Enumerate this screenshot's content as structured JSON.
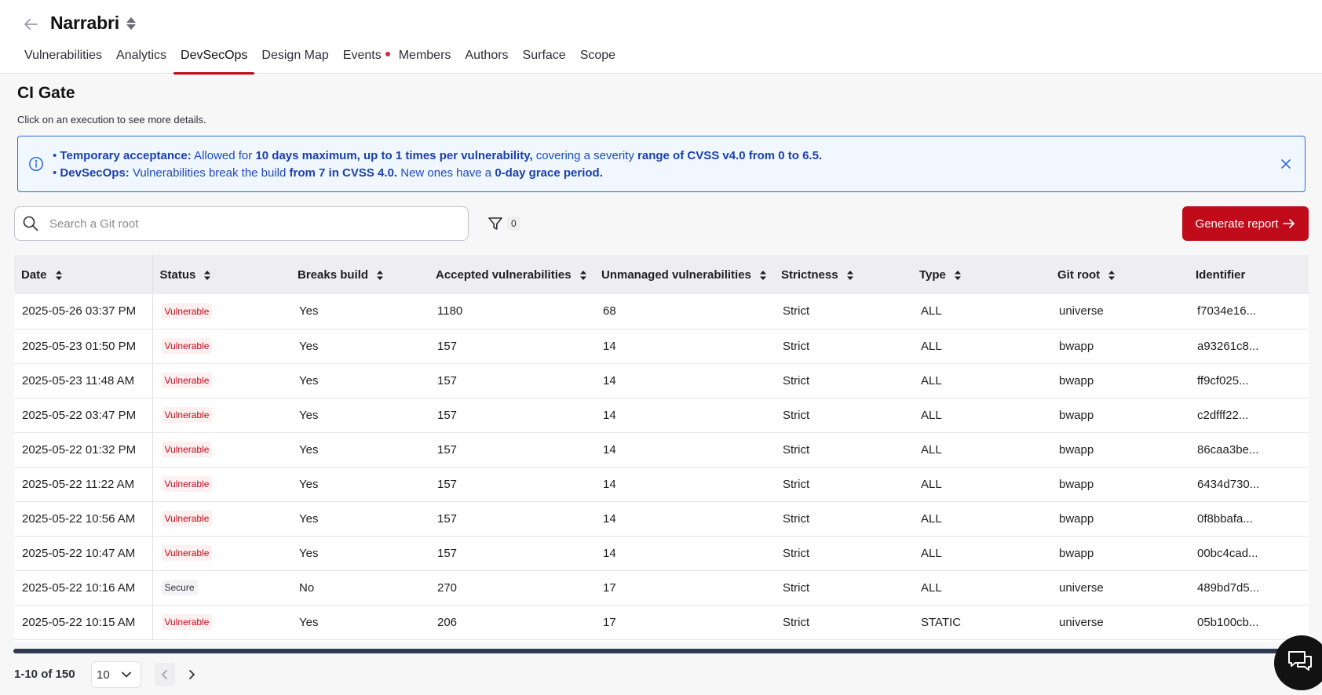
{
  "header": {
    "title": "Narrabri",
    "tabs": [
      {
        "label": "Vulnerabilities"
      },
      {
        "label": "Analytics"
      },
      {
        "label": "DevSecOps"
      },
      {
        "label": "Design Map"
      },
      {
        "label": "Events"
      },
      {
        "label": "Members"
      },
      {
        "label": "Authors"
      },
      {
        "label": "Surface"
      },
      {
        "label": "Scope"
      }
    ],
    "active_tab": "DevSecOps"
  },
  "main": {
    "title": "CI Gate",
    "subtitle": "Click on an execution to see more details.",
    "info": {
      "line1_label": "Temporary acceptance:",
      "line1_text1": " Allowed for ",
      "line1_bold1": "10 days maximum, up to 1 times per vulnerability,",
      "line1_text2": " covering a severity ",
      "line1_bold2": "range of CVSS v4.0 from 0 to 6.5.",
      "line2_label": "DevSecOps:",
      "line2_text1": " Vulnerabilities break the build ",
      "line2_bold1": "from 7 in CVSS 4.0.",
      "line2_text2": " New ones have a ",
      "line2_bold2": "0-day grace period."
    },
    "search": {
      "placeholder": "Search a Git root",
      "value": ""
    },
    "filter_count": "0",
    "generate_report": "Generate report"
  },
  "table": {
    "columns": [
      "Date",
      "Status",
      "Breaks build",
      "Accepted vulnerabilities",
      "Unmanaged vulnerabilities",
      "Strictness",
      "Type",
      "Git root",
      "Identifier"
    ],
    "rows": [
      {
        "date": "2025-05-26 03:37 PM",
        "status": "Vulnerable",
        "breaks": "Yes",
        "accepted": "1180",
        "unmanaged": "68",
        "strictness": "Strict",
        "type": "ALL",
        "root": "universe",
        "id": "f7034e16..."
      },
      {
        "date": "2025-05-23 01:50 PM",
        "status": "Vulnerable",
        "breaks": "Yes",
        "accepted": "157",
        "unmanaged": "14",
        "strictness": "Strict",
        "type": "ALL",
        "root": "bwapp",
        "id": "a93261c8..."
      },
      {
        "date": "2025-05-23 11:48 AM",
        "status": "Vulnerable",
        "breaks": "Yes",
        "accepted": "157",
        "unmanaged": "14",
        "strictness": "Strict",
        "type": "ALL",
        "root": "bwapp",
        "id": "ff9cf025..."
      },
      {
        "date": "2025-05-22 03:47 PM",
        "status": "Vulnerable",
        "breaks": "Yes",
        "accepted": "157",
        "unmanaged": "14",
        "strictness": "Strict",
        "type": "ALL",
        "root": "bwapp",
        "id": "c2dfff22..."
      },
      {
        "date": "2025-05-22 01:32 PM",
        "status": "Vulnerable",
        "breaks": "Yes",
        "accepted": "157",
        "unmanaged": "14",
        "strictness": "Strict",
        "type": "ALL",
        "root": "bwapp",
        "id": "86caa3be..."
      },
      {
        "date": "2025-05-22 11:22 AM",
        "status": "Vulnerable",
        "breaks": "Yes",
        "accepted": "157",
        "unmanaged": "14",
        "strictness": "Strict",
        "type": "ALL",
        "root": "bwapp",
        "id": "6434d730..."
      },
      {
        "date": "2025-05-22 10:56 AM",
        "status": "Vulnerable",
        "breaks": "Yes",
        "accepted": "157",
        "unmanaged": "14",
        "strictness": "Strict",
        "type": "ALL",
        "root": "bwapp",
        "id": "0f8bbafa..."
      },
      {
        "date": "2025-05-22 10:47 AM",
        "status": "Vulnerable",
        "breaks": "Yes",
        "accepted": "157",
        "unmanaged": "14",
        "strictness": "Strict",
        "type": "ALL",
        "root": "bwapp",
        "id": "00bc4cad..."
      },
      {
        "date": "2025-05-22 10:16 AM",
        "status": "Secure",
        "breaks": "No",
        "accepted": "270",
        "unmanaged": "17",
        "strictness": "Strict",
        "type": "ALL",
        "root": "universe",
        "id": "489bd7d5..."
      },
      {
        "date": "2025-05-22 10:15 AM",
        "status": "Vulnerable",
        "breaks": "Yes",
        "accepted": "206",
        "unmanaged": "17",
        "strictness": "Strict",
        "type": "STATIC",
        "root": "universe",
        "id": "05b100cb..."
      }
    ]
  },
  "pagination": {
    "range": "1-10 of 150",
    "page_size": "10"
  },
  "colors": {
    "accent": "#bf0b1a",
    "info_border": "#2e6bd6",
    "info_text": "#1d4ac2"
  }
}
